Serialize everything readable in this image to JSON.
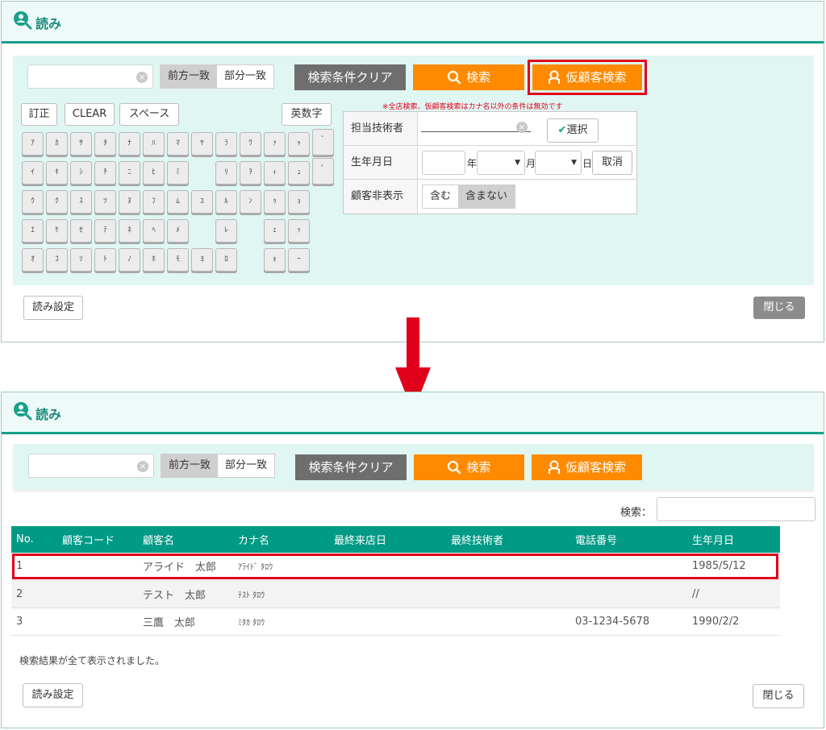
{
  "app": {
    "title": "読み"
  },
  "search": {
    "prefix_label": "前方一致",
    "partial_label": "部分一致",
    "clear_conditions_label": "検索条件クリア",
    "search_label": "検索",
    "temp_search_label": "仮顧客検索"
  },
  "keyboard": {
    "correct_label": "訂正",
    "clear_label": "CLEAR",
    "space_label": "スペース",
    "alnum_label": "英数字",
    "rows": [
      [
        "ｱ",
        "ｶ",
        "ｻ",
        "ﾀ",
        "ﾅ",
        "ﾊ",
        "ﾏ",
        "ﾔ",
        "ﾗ",
        "ﾜ",
        "ｧ",
        "ｬ",
        "ﾞ"
      ],
      [
        "ｲ",
        "ｷ",
        "ｼ",
        "ﾁ",
        "ﾆ",
        "ﾋ",
        "ﾐ",
        "",
        "ﾘ",
        "ｦ",
        "ｨ",
        "ｭ",
        "ﾟ"
      ],
      [
        "ｳ",
        "ｸ",
        "ｽ",
        "ﾂ",
        "ﾇ",
        "ﾌ",
        "ﾑ",
        "ﾕ",
        "ﾙ",
        "ﾝ",
        "ｩ",
        "ｮ"
      ],
      [
        "ｴ",
        "ｹ",
        "ｾ",
        "ﾃ",
        "ﾈ",
        "ﾍ",
        "ﾒ",
        "",
        "ﾚ",
        "",
        "ｪ",
        "ｯ"
      ],
      [
        "ｵ",
        "ｺ",
        "ｿ",
        "ﾄ",
        "ﾉ",
        "ﾎ",
        "ﾓ",
        "ﾖ",
        "ﾛ",
        "",
        "ｫ",
        "ｰ"
      ]
    ]
  },
  "conditions": {
    "warning": "※全店検索、仮顧客検索はカナ名以外の条件は無効です",
    "technician_label": "担当技術者",
    "select_label": "選択",
    "birth_label": "生年月日",
    "year_unit": "年",
    "month_unit": "月",
    "day_unit": "日",
    "cancel_label": "取消",
    "hidden_label": "顧客非表示",
    "include_label": "含む",
    "exclude_label": "含まない"
  },
  "footer": {
    "settings_label": "読み設定",
    "close_label": "閉じる"
  },
  "results": {
    "search_label": "検索：",
    "columns": [
      "No.",
      "顧客コード",
      "顧客名",
      "カナ名",
      "最終来店日",
      "最終技術者",
      "電話番号",
      "生年月日"
    ],
    "rows": [
      {
        "no": "1",
        "code": "",
        "name": "アライド　太郎",
        "kana": "ｱﾗｲﾄﾞ ﾀﾛｳ",
        "last_visit": "",
        "last_tech": "",
        "phone": "",
        "birth": "1985/5/12"
      },
      {
        "no": "2",
        "code": "",
        "name": "テスト　太郎",
        "kana": "ﾃｽﾄ ﾀﾛｳ",
        "last_visit": "",
        "last_tech": "",
        "phone": "",
        "birth": "//"
      },
      {
        "no": "3",
        "code": "",
        "name": "三鷹　太郎",
        "kana": "ﾐﾀｶ ﾀﾛｳ",
        "last_visit": "",
        "last_tech": "",
        "phone": "03-1234-5678",
        "birth": "1990/2/2"
      }
    ],
    "message": "検索結果が全て表示されました。"
  },
  "colors": {
    "accent": "#17a08b",
    "orange": "#ff8a00",
    "highlight": "#e0001b",
    "header_bg": "#009a85"
  }
}
